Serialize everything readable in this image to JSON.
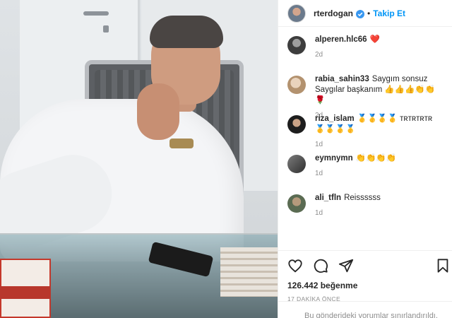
{
  "post": {
    "username": "rterdogan",
    "follow_label": "Takip Et",
    "separator": "•",
    "likes": "126.442 beğenme",
    "time": "17 DAKİKA ÖNCE",
    "comments_limited": "Bu gönderideki yorumlar sınırlandırıldı."
  },
  "comments": [
    {
      "username": "alperen.hlc66",
      "text": "❤️",
      "time": "2d"
    },
    {
      "username": "rabia_sahin33",
      "text": "Saygım sonsuz Saygılar başkanım 👍👍👍👏👏🌹",
      "time": "2d"
    },
    {
      "username": "riza_islam",
      "text": "🥇🥇🥇🥇 ᴛʀᴛʀᴛʀᴛʀ 🥇🥇🥇🥇",
      "time": "1d"
    },
    {
      "username": "eymnymn",
      "text": "👏👏👏👏",
      "time": "1d"
    },
    {
      "username": "ali_tfln",
      "text": "Reissssss",
      "time": "1d"
    }
  ],
  "icons": [
    "heart-icon",
    "comment-icon",
    "share-icon",
    "bookmark-icon",
    "verified-badge-icon"
  ],
  "colors": {
    "link": "#0095f6",
    "muted": "#8e8e8e",
    "text": "#262626",
    "verified": "#3897f0"
  }
}
